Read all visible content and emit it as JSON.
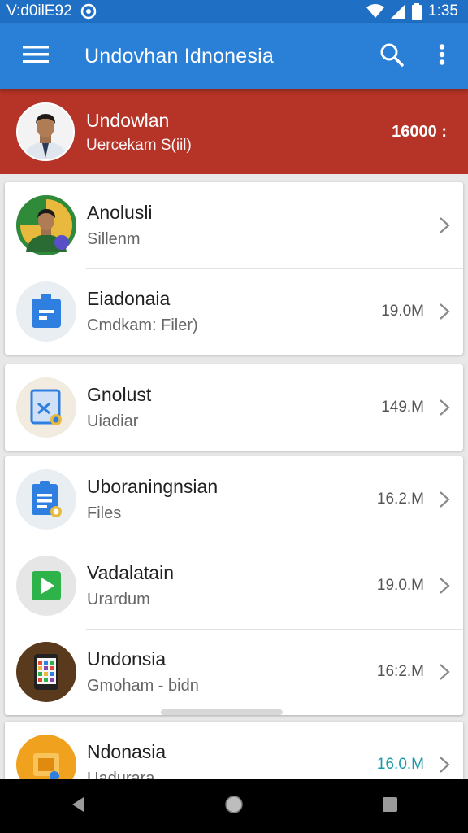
{
  "status_bar": {
    "left_text": "V:d0ilE92",
    "time": "1:35"
  },
  "app_bar": {
    "title": "Undovhan Idnonesia"
  },
  "banner": {
    "name": "Undowlan",
    "subtitle": "Uercekam S(iil)",
    "value": "16000 :"
  },
  "cards": [
    {
      "rows": [
        {
          "title": "Anolusli",
          "subtitle": "Sillenm",
          "size": "",
          "icon": "person-avatar-icon"
        },
        {
          "title": "Eiadonaia",
          "subtitle": "Cmdkam: Filer)",
          "size": "19.0M",
          "icon": "blue-clipboard-icon"
        }
      ]
    },
    {
      "rows": [
        {
          "title": "Gnolust",
          "subtitle": "Uiadiar",
          "size": "149.M",
          "icon": "image-file-icon"
        }
      ]
    },
    {
      "rows": [
        {
          "title": "Uboraningnsian",
          "subtitle": "Files",
          "size": "16.2.M",
          "icon": "document-file-icon"
        },
        {
          "title": "Vadalatain",
          "subtitle": "Urardum",
          "size": "19.0.M",
          "icon": "play-video-icon"
        },
        {
          "title": "Undonsia",
          "subtitle": "Gmoham - bidn",
          "size": "16:2.M",
          "icon": "phone-apps-icon"
        }
      ]
    },
    {
      "rows": [
        {
          "title": "Ndonasia",
          "subtitle": "Uadurara",
          "size": "16.0.M",
          "icon": "orange-folder-icon"
        }
      ]
    }
  ],
  "colors": {
    "app_bar": "#2a7fd6",
    "status_bar": "#1f6fc4",
    "banner": "#b53327",
    "teal_size": "#1a9aa8"
  }
}
